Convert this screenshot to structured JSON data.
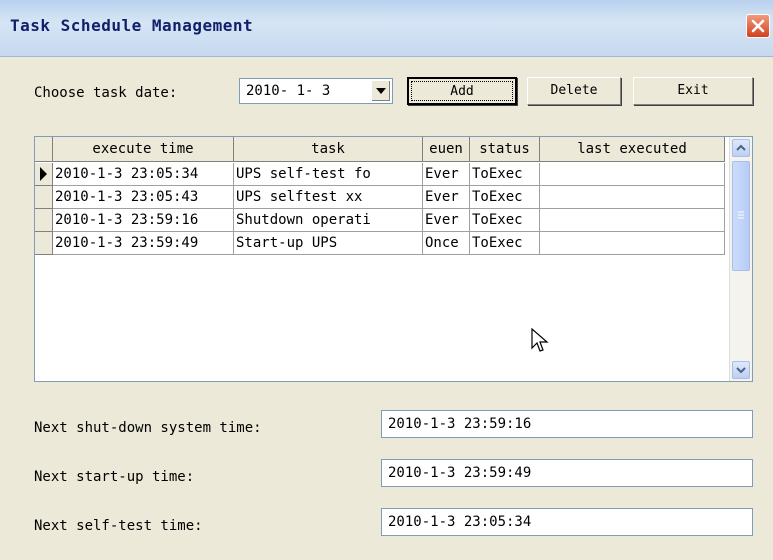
{
  "window": {
    "title": "Task Schedule Management"
  },
  "date_picker": {
    "label": "Choose task date:",
    "value": "2010- 1- 3"
  },
  "buttons": {
    "add": "Add",
    "delete": "Delete",
    "exit": "Exit"
  },
  "grid": {
    "columns": [
      "execute time",
      "task",
      "euen",
      "status",
      "last executed"
    ],
    "rows": [
      {
        "execute_time": "2010-1-3 23:05:34",
        "task": "UPS self-test fo",
        "euen": "Ever",
        "status": "ToExec",
        "last_executed": ""
      },
      {
        "execute_time": "2010-1-3 23:05:43",
        "task": "UPS selftest  xx",
        "euen": "Ever",
        "status": "ToExec",
        "last_executed": ""
      },
      {
        "execute_time": "2010-1-3 23:59:16",
        "task": "Shutdown operati",
        "euen": "Ever",
        "status": "ToExec",
        "last_executed": ""
      },
      {
        "execute_time": "2010-1-3 23:59:49",
        "task": "Start-up UPS",
        "euen": "Once",
        "status": "ToExec",
        "last_executed": ""
      }
    ]
  },
  "info": {
    "shutdown_label": "Next shut-down system time:",
    "shutdown_value": "2010-1-3 23:59:16",
    "startup_label": "Next start-up time:",
    "startup_value": "2010-1-3 23:59:49",
    "selftest_label": "Next self-test time:",
    "selftest_value": "2010-1-3 23:05:34"
  },
  "colors": {
    "titlebar": "#c6d9f0",
    "title_text": "#10206a",
    "close": "#d2421f",
    "face": "#ece9d8"
  }
}
